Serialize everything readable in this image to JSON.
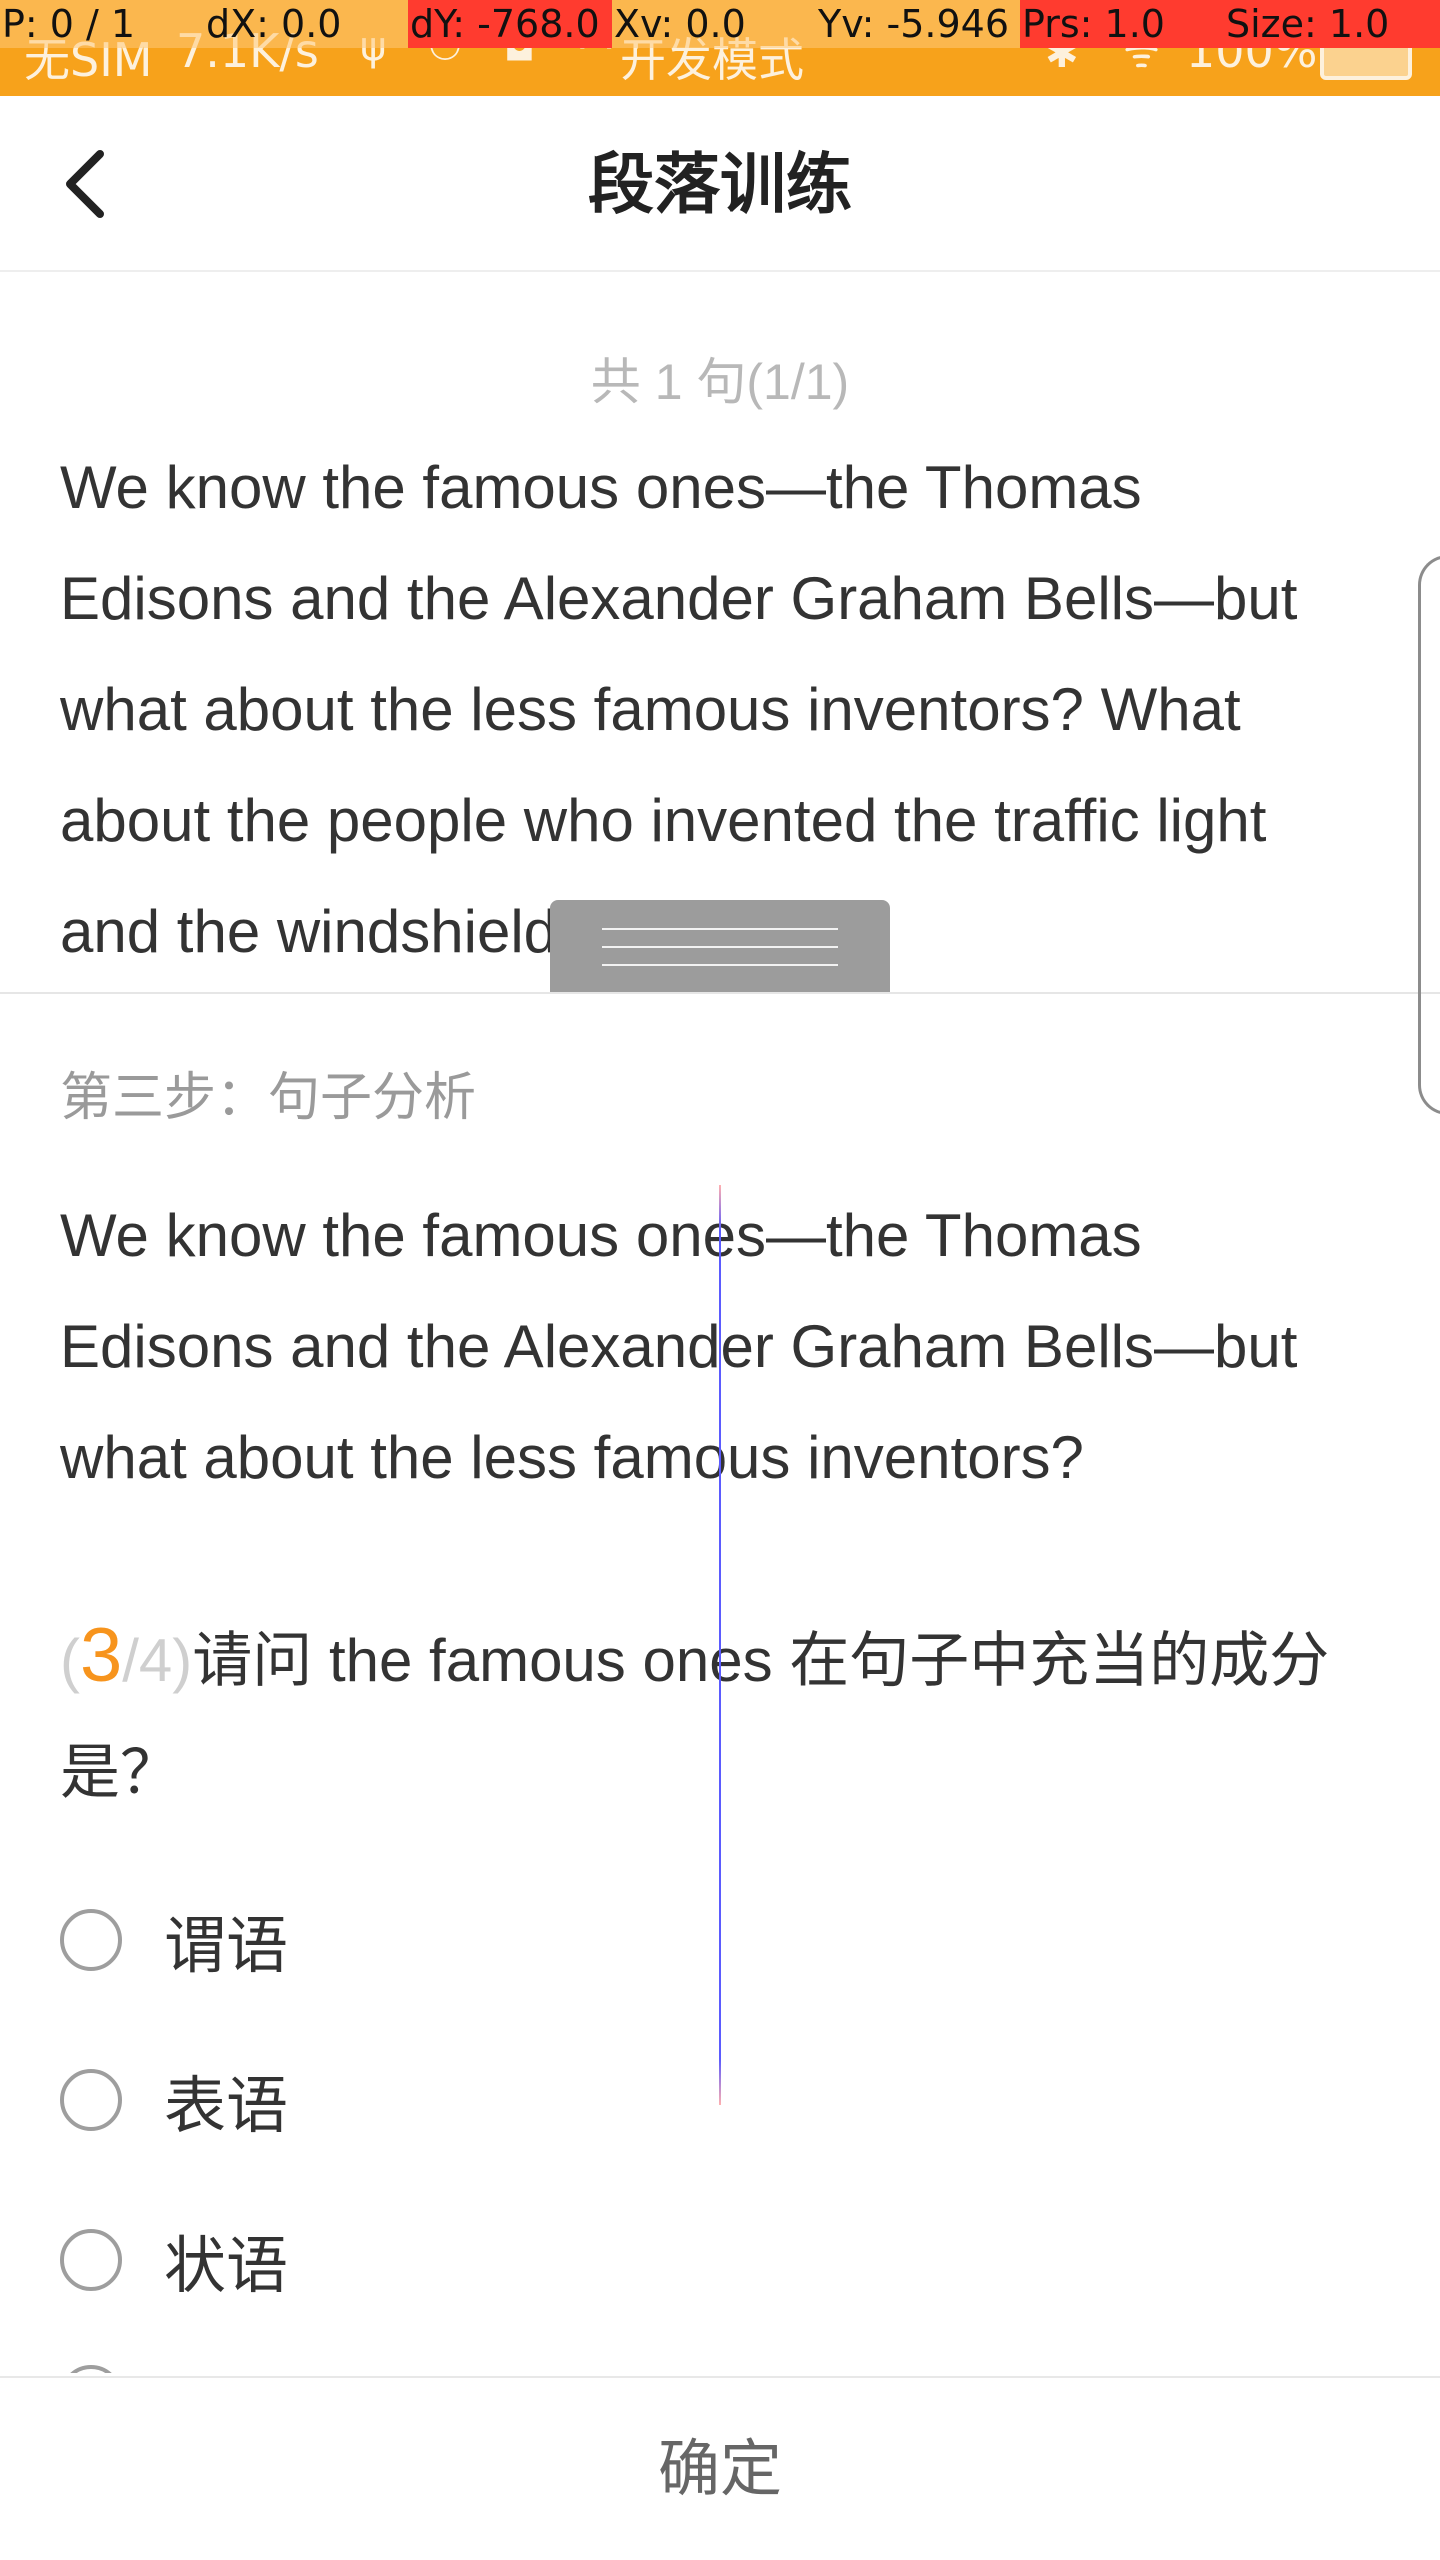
{
  "status_bar": {
    "carrier": "无SIM",
    "network_speed": "7.1K/s",
    "notification_icons": "ψ ⚇ ◘ ···",
    "mode": "开发模式",
    "system_icons": "✱ ᯤ",
    "battery": "100%"
  },
  "debug_overlay": {
    "p": "P: 0 / 1",
    "dx": "dX: 0.0",
    "dy": "dY: -768.0",
    "xv": "Xv: 0.0",
    "yv": "Yv: -5.946",
    "prs": "Prs: 1.0",
    "size": "Size: 1.0"
  },
  "header": {
    "title": "段落训练"
  },
  "passage": {
    "sentence_count": "共 1 句(1/1)",
    "text": "We know the famous ones—the Thomas Edisons and the Alexander Graham Bells—but what about the less famous inventors? What about the people who invented the traffic light and the windshield wiper (雨刮"
  },
  "analysis": {
    "step_label": "第三步：句子分析",
    "sentence": "We know the famous ones—the Thomas Edisons and the Alexander Graham Bells—but what about the less famous inventors?",
    "question": {
      "paren_open": "(",
      "current": "3",
      "total": "/4)",
      "text": "请问 the famous ones 在句子中充当的成分是？"
    },
    "options": [
      {
        "label": "谓语"
      },
      {
        "label": "表语"
      },
      {
        "label": "状语"
      }
    ]
  },
  "footer": {
    "confirm_label": "确定"
  }
}
